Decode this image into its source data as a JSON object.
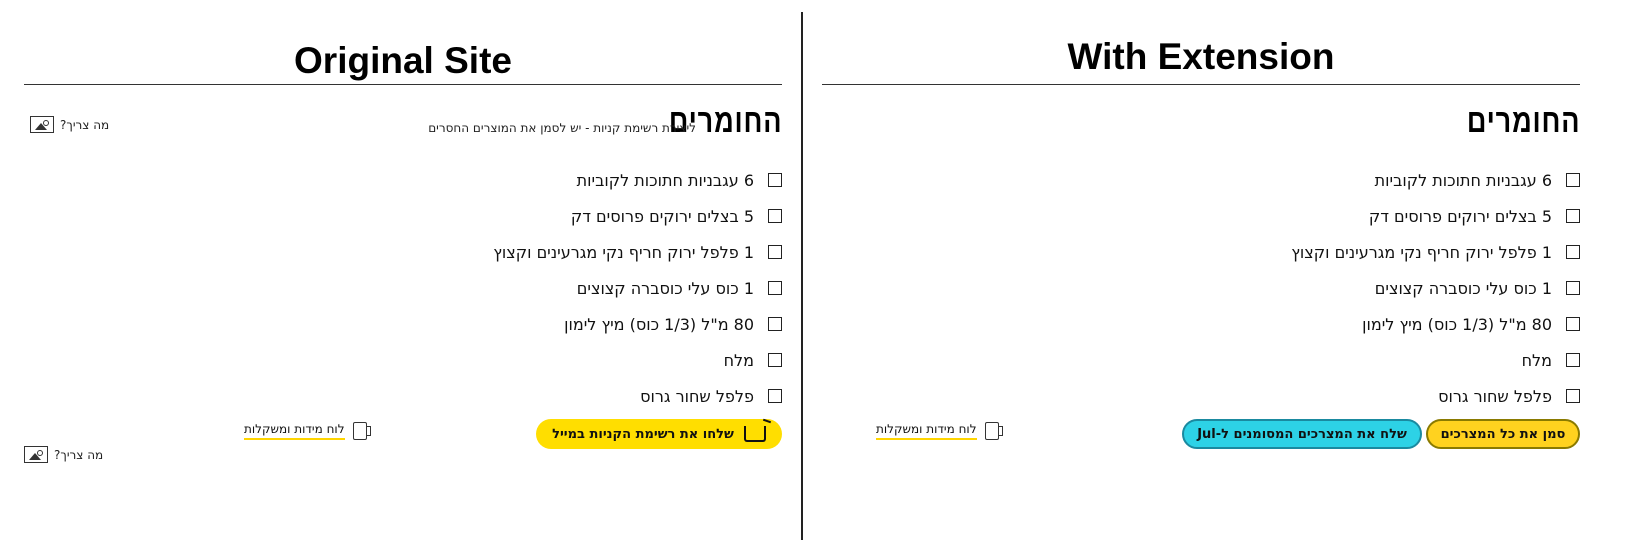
{
  "original": {
    "title": "Original Site",
    "heading": "החומרים",
    "hint": "ליצירת רשימת קניות - יש לסמן את המוצרים החסרים",
    "what_needed": "מה צריך?",
    "ingredients": [
      "6 עגבניות חתוכות לקוביות",
      "5 בצלים ירוקים פרוסים דק",
      "1 פלפל ירוק חריף נקי מגרעינים וקצוץ",
      "1 כוס עלי כוסברה קצוצים",
      "80 מ\"ל (1/3 כוס) מיץ לימון",
      "מלח",
      "פלפל שחור גרוס"
    ],
    "measure_label": "לוח מידות ומשקלות",
    "email_button": "שלחו את רשימת הקניות במייל"
  },
  "extension": {
    "title": "With Extension",
    "heading": "החומרים",
    "ingredients": [
      "6 עגבניות חתוכות לקוביות",
      "5 בצלים ירוקים פרוסים דק",
      "1 פלפל ירוק חריף נקי מגרעינים וקצוץ",
      "1 כוס עלי כוסברה קצוצים",
      "80 מ\"ל (1/3 כוס) מיץ לימון",
      "מלח",
      "פלפל שחור גרוס"
    ],
    "measure_label": "לוח מידות ומשקלות",
    "mark_all_button": "סמן את כל המצרכים",
    "send_button": "שלח את המצרכים המסומנים ל-Jul"
  },
  "icons": {
    "image": "image-icon",
    "cart": "cart-icon",
    "measuring_cup": "measuring-cup-icon"
  },
  "colors": {
    "yellow": "#ffde00",
    "cyan": "#2dd2e6"
  }
}
